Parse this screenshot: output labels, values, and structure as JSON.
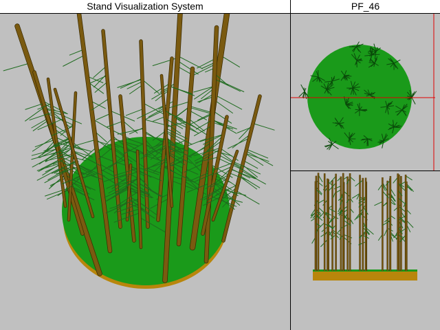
{
  "window": {
    "main_title": "Stand Visualization System",
    "plot_id": "PF_46"
  },
  "views": {
    "perspective": {
      "name": "perspective-view"
    },
    "top": {
      "name": "top-view",
      "crosshair_color": "#e00000"
    },
    "side": {
      "name": "side-view"
    }
  },
  "colors": {
    "ground": "#1a9a1a",
    "ground_dark": "#0f7f0f",
    "soil": "#b8860b",
    "stem": "#7a5a10",
    "stem_dark": "#3a2a00",
    "foliage": "#1e6a1e",
    "background": "#c0c0c0"
  }
}
